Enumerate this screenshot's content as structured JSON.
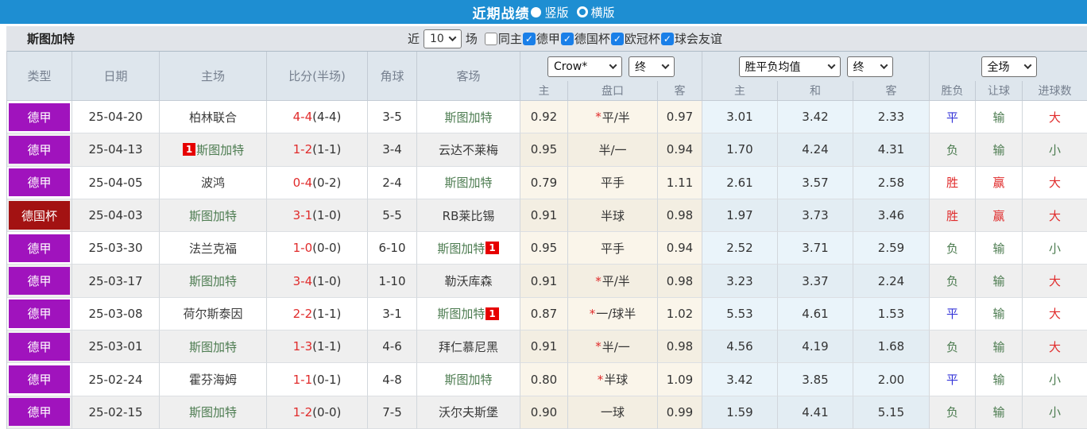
{
  "topbar": {
    "title": "近期战绩",
    "radio_options": [
      {
        "label": "竖版",
        "selected": true
      },
      {
        "label": "横版",
        "selected": false
      }
    ]
  },
  "filterbar": {
    "team": "斯图加特",
    "near_label": "近",
    "count_value": "10",
    "games_label": "场",
    "filters": [
      {
        "label": "同主",
        "checked": false
      },
      {
        "label": "德甲",
        "checked": true
      },
      {
        "label": "德国杯",
        "checked": true
      },
      {
        "label": "欧冠杯",
        "checked": true
      },
      {
        "label": "球会友谊",
        "checked": true
      }
    ]
  },
  "header": {
    "main_columns": [
      "类型",
      "日期",
      "主场",
      "比分(半场)",
      "角球",
      "客场"
    ],
    "selects": [
      "Crow*",
      "终",
      "胜平负均值",
      "终",
      "全场"
    ],
    "sub_columns": [
      "主",
      "盘口",
      "客",
      "主",
      "和",
      "客",
      "胜负",
      "让球",
      "进球数"
    ]
  },
  "colors": {
    "accent_blue": "#1e8ed2",
    "purple": "#a013bd",
    "darkred": "#a31212",
    "red": "#e02b2b",
    "green": "#4d7c51",
    "blue": "#3434d8"
  },
  "rows": [
    {
      "league": "德甲",
      "league_type": "purple",
      "date": "25-04-20",
      "home": {
        "name": "柏林联合",
        "green": false,
        "badge": ""
      },
      "score_ft": "4-4",
      "score_ht": "(4-4)",
      "corners": "3-5",
      "away": {
        "name": "斯图加特",
        "green": true,
        "badge": ""
      },
      "crow_home": "0.92",
      "handicap_star": true,
      "handicap": "平/半",
      "crow_away": "0.97",
      "avg": [
        "3.01",
        "3.42",
        "2.33"
      ],
      "results": [
        {
          "text": "平",
          "color": "blue"
        },
        {
          "text": "输",
          "color": "green"
        },
        {
          "text": "大",
          "color": "red"
        }
      ]
    },
    {
      "league": "德甲",
      "league_type": "purple",
      "date": "25-04-13",
      "home": {
        "name": "斯图加特",
        "green": true,
        "badge": "1",
        "badge_pos": "before"
      },
      "score_ft": "1-2",
      "score_ht": "(1-1)",
      "corners": "3-4",
      "away": {
        "name": "云达不莱梅",
        "green": false,
        "badge": ""
      },
      "crow_home": "0.95",
      "handicap_star": false,
      "handicap": "半/一",
      "crow_away": "0.94",
      "avg": [
        "1.70",
        "4.24",
        "4.31"
      ],
      "results": [
        {
          "text": "负",
          "color": "green"
        },
        {
          "text": "输",
          "color": "green"
        },
        {
          "text": "小",
          "color": "green"
        }
      ]
    },
    {
      "league": "德甲",
      "league_type": "purple",
      "date": "25-04-05",
      "home": {
        "name": "波鸿",
        "green": false,
        "badge": ""
      },
      "score_ft": "0-4",
      "score_ht": "(0-2)",
      "corners": "2-4",
      "away": {
        "name": "斯图加特",
        "green": true,
        "badge": ""
      },
      "crow_home": "0.79",
      "handicap_star": false,
      "handicap": "平手",
      "crow_away": "1.11",
      "avg": [
        "2.61",
        "3.57",
        "2.58"
      ],
      "results": [
        {
          "text": "胜",
          "color": "red"
        },
        {
          "text": "赢",
          "color": "red"
        },
        {
          "text": "大",
          "color": "red"
        }
      ]
    },
    {
      "league": "德国杯",
      "league_type": "darkred",
      "date": "25-04-03",
      "home": {
        "name": "斯图加特",
        "green": true,
        "badge": ""
      },
      "score_ft": "3-1",
      "score_ht": "(1-0)",
      "corners": "5-5",
      "away": {
        "name": "RB莱比锡",
        "green": false,
        "badge": ""
      },
      "crow_home": "0.91",
      "handicap_star": false,
      "handicap": "半球",
      "crow_away": "0.98",
      "avg": [
        "1.97",
        "3.73",
        "3.46"
      ],
      "results": [
        {
          "text": "胜",
          "color": "red"
        },
        {
          "text": "赢",
          "color": "red"
        },
        {
          "text": "大",
          "color": "red"
        }
      ]
    },
    {
      "league": "德甲",
      "league_type": "purple",
      "date": "25-03-30",
      "home": {
        "name": "法兰克福",
        "green": false,
        "badge": ""
      },
      "score_ft": "1-0",
      "score_ht": "(0-0)",
      "corners": "6-10",
      "away": {
        "name": "斯图加特",
        "green": true,
        "badge": "1",
        "badge_pos": "after"
      },
      "crow_home": "0.95",
      "handicap_star": false,
      "handicap": "平手",
      "crow_away": "0.94",
      "avg": [
        "2.52",
        "3.71",
        "2.59"
      ],
      "results": [
        {
          "text": "负",
          "color": "green"
        },
        {
          "text": "输",
          "color": "green"
        },
        {
          "text": "小",
          "color": "green"
        }
      ]
    },
    {
      "league": "德甲",
      "league_type": "purple",
      "date": "25-03-17",
      "home": {
        "name": "斯图加特",
        "green": true,
        "badge": ""
      },
      "score_ft": "3-4",
      "score_ht": "(1-0)",
      "corners": "1-10",
      "away": {
        "name": "勒沃库森",
        "green": false,
        "badge": ""
      },
      "crow_home": "0.91",
      "handicap_star": true,
      "handicap": "平/半",
      "crow_away": "0.98",
      "avg": [
        "3.23",
        "3.37",
        "2.24"
      ],
      "results": [
        {
          "text": "负",
          "color": "green"
        },
        {
          "text": "输",
          "color": "green"
        },
        {
          "text": "大",
          "color": "red"
        }
      ]
    },
    {
      "league": "德甲",
      "league_type": "purple",
      "date": "25-03-08",
      "home": {
        "name": "荷尔斯泰因",
        "green": false,
        "badge": ""
      },
      "score_ft": "2-2",
      "score_ht": "(1-1)",
      "corners": "3-1",
      "away": {
        "name": "斯图加特",
        "green": true,
        "badge": "1",
        "badge_pos": "after"
      },
      "crow_home": "0.87",
      "handicap_star": true,
      "handicap": "一/球半",
      "crow_away": "1.02",
      "avg": [
        "5.53",
        "4.61",
        "1.53"
      ],
      "results": [
        {
          "text": "平",
          "color": "blue"
        },
        {
          "text": "输",
          "color": "green"
        },
        {
          "text": "大",
          "color": "red"
        }
      ]
    },
    {
      "league": "德甲",
      "league_type": "purple",
      "date": "25-03-01",
      "home": {
        "name": "斯图加特",
        "green": true,
        "badge": ""
      },
      "score_ft": "1-3",
      "score_ht": "(1-1)",
      "corners": "4-6",
      "away": {
        "name": "拜仁慕尼黑",
        "green": false,
        "badge": ""
      },
      "crow_home": "0.91",
      "handicap_star": true,
      "handicap": "半/一",
      "crow_away": "0.98",
      "avg": [
        "4.56",
        "4.19",
        "1.68"
      ],
      "results": [
        {
          "text": "负",
          "color": "green"
        },
        {
          "text": "输",
          "color": "green"
        },
        {
          "text": "大",
          "color": "red"
        }
      ]
    },
    {
      "league": "德甲",
      "league_type": "purple",
      "date": "25-02-24",
      "home": {
        "name": "霍芬海姆",
        "green": false,
        "badge": ""
      },
      "score_ft": "1-1",
      "score_ht": "(0-1)",
      "corners": "4-8",
      "away": {
        "name": "斯图加特",
        "green": true,
        "badge": ""
      },
      "crow_home": "0.80",
      "handicap_star": true,
      "handicap": "半球",
      "crow_away": "1.09",
      "avg": [
        "3.42",
        "3.85",
        "2.00"
      ],
      "results": [
        {
          "text": "平",
          "color": "blue"
        },
        {
          "text": "输",
          "color": "green"
        },
        {
          "text": "小",
          "color": "green"
        }
      ]
    },
    {
      "league": "德甲",
      "league_type": "purple",
      "date": "25-02-15",
      "home": {
        "name": "斯图加特",
        "green": true,
        "badge": ""
      },
      "score_ft": "1-2",
      "score_ht": "(0-0)",
      "corners": "7-5",
      "away": {
        "name": "沃尔夫斯堡",
        "green": false,
        "badge": ""
      },
      "crow_home": "0.90",
      "handicap_star": false,
      "handicap": "一球",
      "crow_away": "0.99",
      "avg": [
        "1.59",
        "4.41",
        "5.15"
      ],
      "results": [
        {
          "text": "负",
          "color": "green"
        },
        {
          "text": "输",
          "color": "green"
        },
        {
          "text": "小",
          "color": "green"
        }
      ]
    }
  ]
}
